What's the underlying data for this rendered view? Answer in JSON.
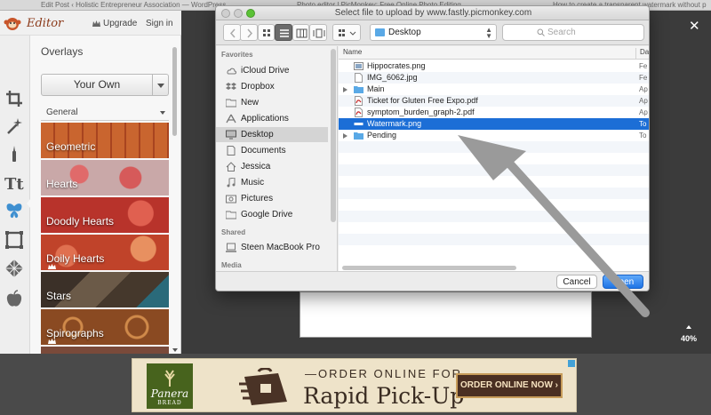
{
  "browser_tabs": [
    "Edit Post ‹ Holistic Entrepreneur Association — WordPress",
    "Photo editor | PicMonkey: Free Online Photo Editing",
    "How to create a transparent watermark without p"
  ],
  "editor": {
    "logo_text": "Editor",
    "upgrade_label": "Upgrade",
    "signin_label": "Sign in",
    "panel_title": "Overlays",
    "your_own_label": "Your Own",
    "category_label": "General",
    "tools": [
      "crop-icon",
      "magic-wand-icon",
      "brush-icon",
      "text-icon",
      "butterfly-icon",
      "frame-icon",
      "texture-icon",
      "apple-icon"
    ],
    "tiles": [
      {
        "label": "Geometric",
        "color": "#b85a2b"
      },
      {
        "label": "Hearts",
        "color": "#c99a9a"
      },
      {
        "label": "Doodly Hearts",
        "color": "#b8332b"
      },
      {
        "label": "Doily Hearts",
        "color": "#c0432a"
      },
      {
        "label": "Stars",
        "color": "#5a4a3a"
      },
      {
        "label": "Spirographs",
        "color": "#9a5a2a"
      }
    ]
  },
  "workspace": {
    "close_label": "✕",
    "zoom_label": "40%"
  },
  "ad": {
    "brand_line1": "Panera",
    "brand_line2": "BREAD",
    "line1": "ORDER ONLINE FOR",
    "line2": "Rapid Pick-Up",
    "button": "ORDER ONLINE NOW ›"
  },
  "dialog": {
    "title": "Select file to upload by www.fastly.picmonkey.com",
    "location": "Desktop",
    "search_placeholder": "Search",
    "sidebar_sections": [
      {
        "heading": "Favorites",
        "items": [
          {
            "label": "iCloud Drive",
            "icon": "cloud-icon"
          },
          {
            "label": "Dropbox",
            "icon": "dropbox-icon"
          },
          {
            "label": "New",
            "icon": "folder-icon"
          },
          {
            "label": "Applications",
            "icon": "applications-icon"
          },
          {
            "label": "Desktop",
            "icon": "desktop-icon",
            "selected": true
          },
          {
            "label": "Documents",
            "icon": "documents-icon"
          },
          {
            "label": "Jessica",
            "icon": "home-icon"
          },
          {
            "label": "Music",
            "icon": "music-icon"
          },
          {
            "label": "Pictures",
            "icon": "pictures-icon"
          },
          {
            "label": "Google Drive",
            "icon": "folder-icon"
          }
        ]
      },
      {
        "heading": "Shared",
        "items": [
          {
            "label": "Steen MacBook Pro",
            "icon": "computer-icon"
          }
        ]
      },
      {
        "heading": "Media",
        "items": []
      }
    ],
    "columns": {
      "name": "Name",
      "date": "Da"
    },
    "files": [
      {
        "name": "Hippocrates.png",
        "date": "Fe",
        "kind": "image"
      },
      {
        "name": "IMG_6062.jpg",
        "date": "Fe",
        "kind": "doc"
      },
      {
        "name": "Main",
        "date": "Ap",
        "kind": "folder",
        "expandable": true
      },
      {
        "name": "Ticket for Gluten Free Expo.pdf",
        "date": "Ap",
        "kind": "pdf"
      },
      {
        "name": "symptom_burden_graph-2.pdf",
        "date": "Ap",
        "kind": "pdf"
      },
      {
        "name": "Watermark.png",
        "date": "To",
        "kind": "image",
        "selected": true
      },
      {
        "name": "Pending",
        "date": "To",
        "kind": "folder",
        "expandable": true
      }
    ],
    "cancel_label": "Cancel",
    "open_label": "Open",
    "colors": {
      "accent": "#1c6ed6",
      "folder": "#5aa9e6"
    }
  }
}
